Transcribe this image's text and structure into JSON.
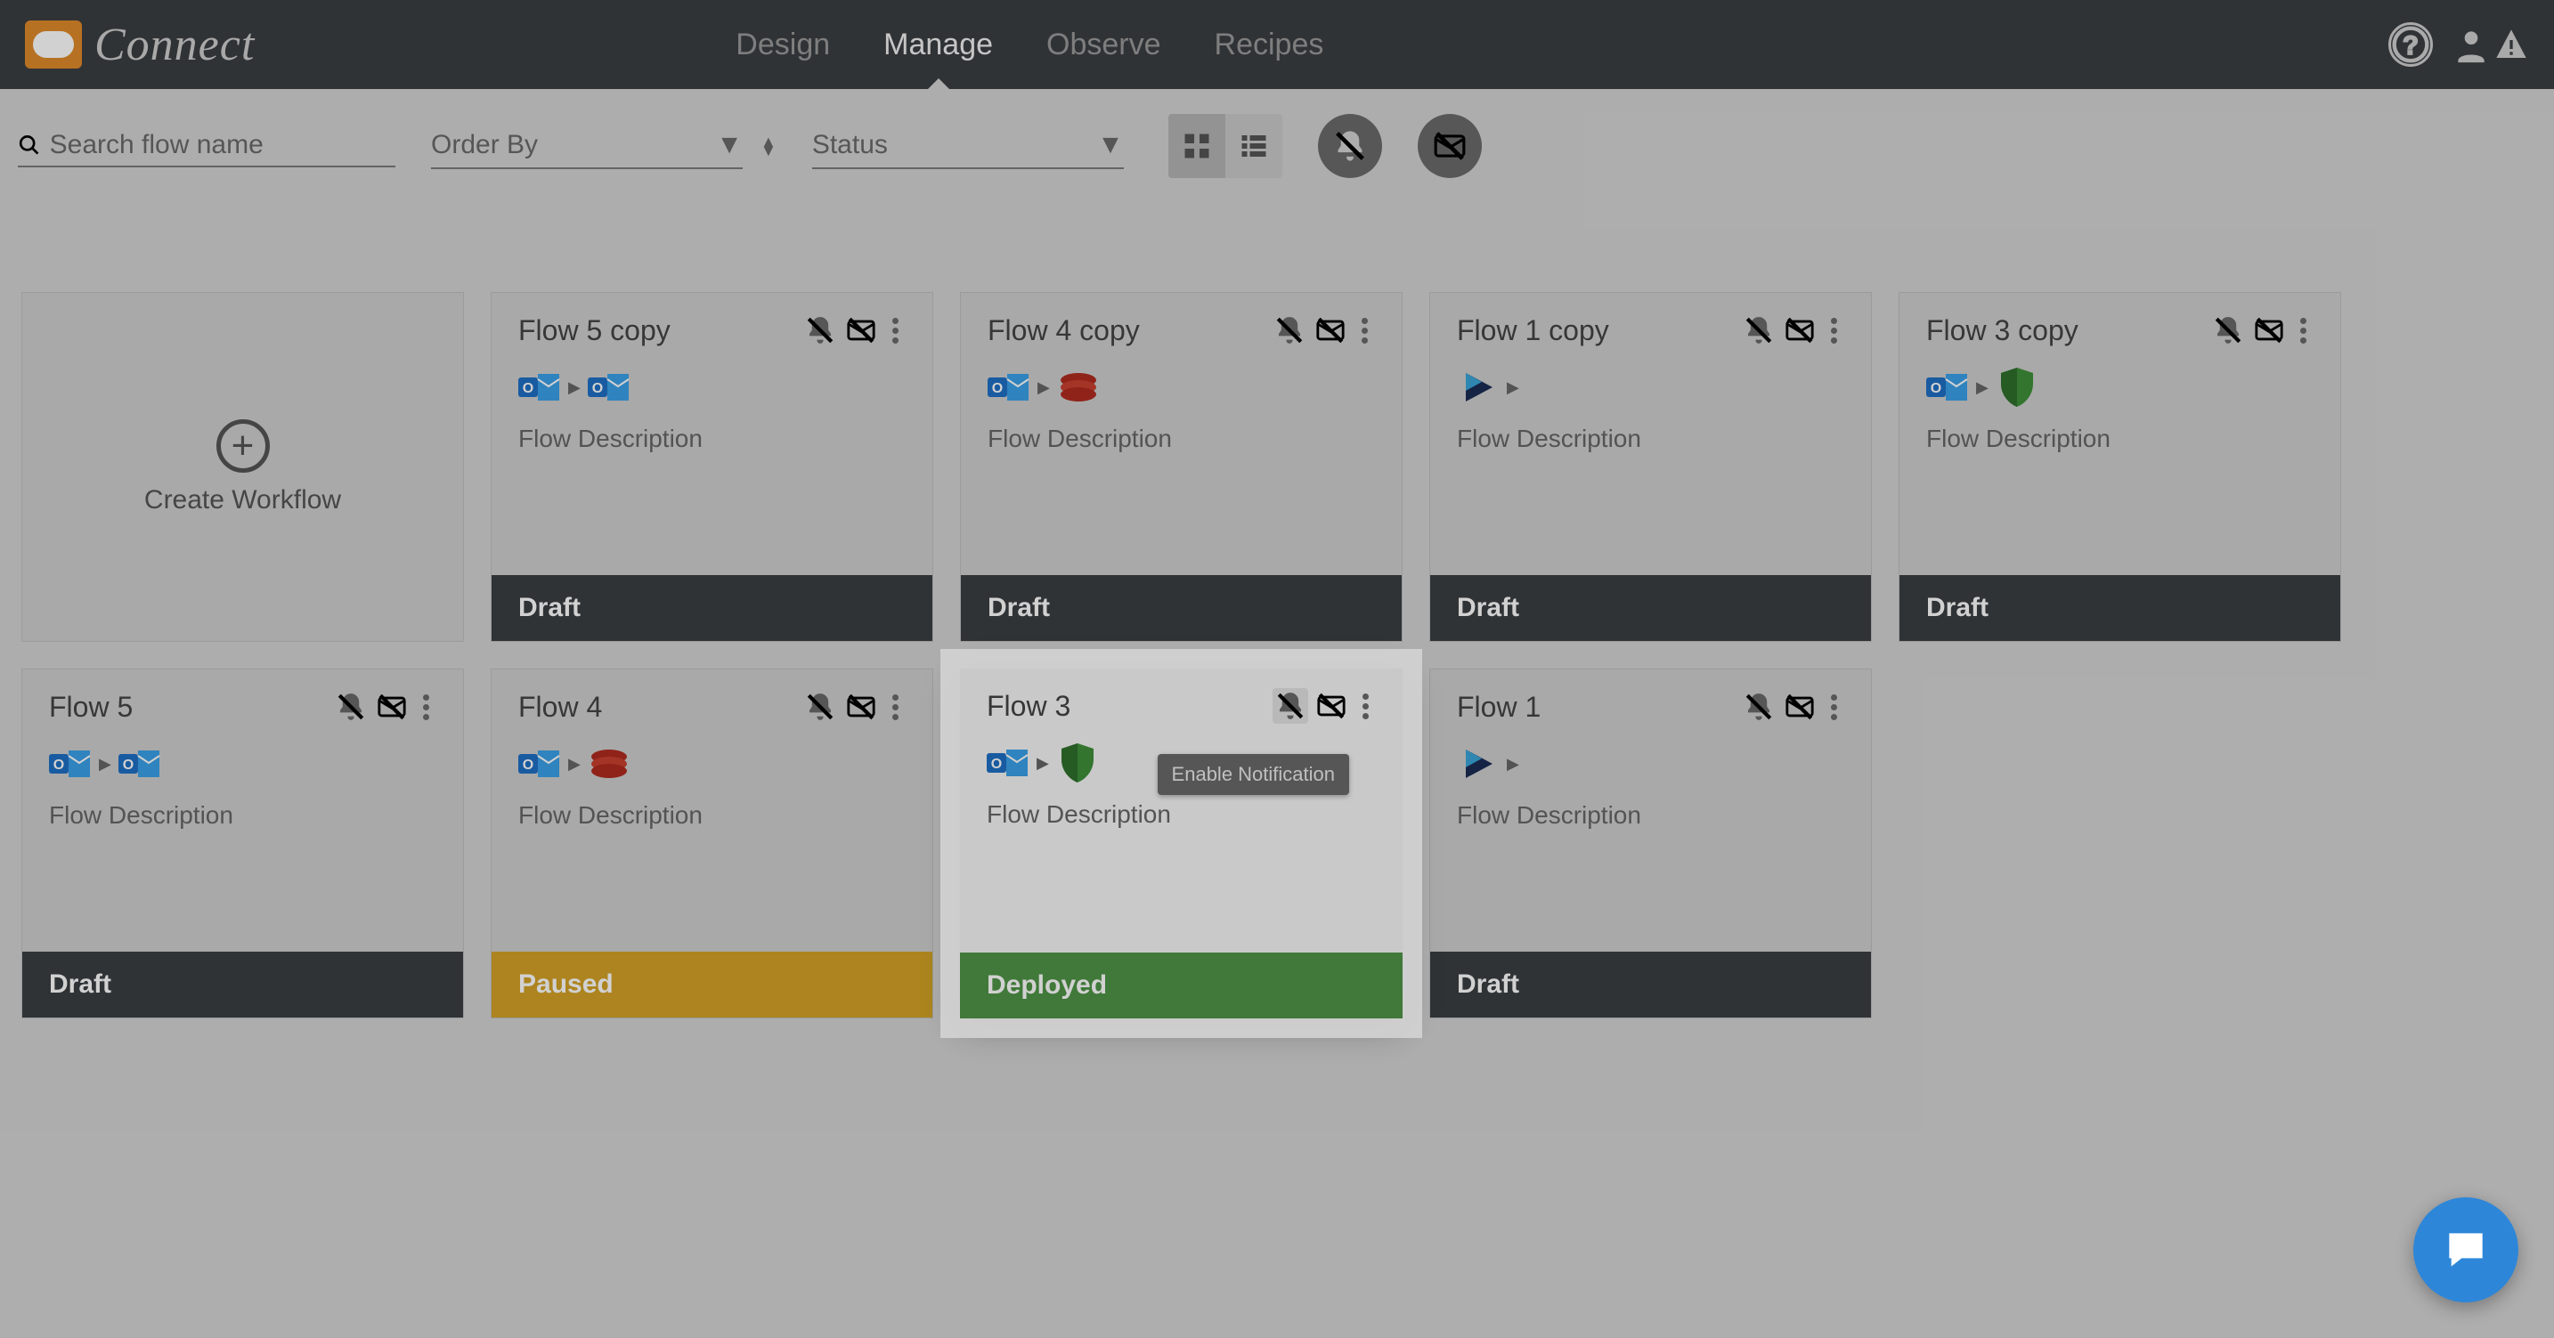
{
  "app": {
    "name": "Connect"
  },
  "nav": {
    "design": "Design",
    "manage": "Manage",
    "observe": "Observe",
    "recipes": "Recipes",
    "active": "manage"
  },
  "toolbar": {
    "search_placeholder": "Search flow name",
    "orderby_label": "Order By",
    "status_label": "Status"
  },
  "create_card": {
    "label": "Create Workflow"
  },
  "tooltip": {
    "enable_notification": "Enable Notification"
  },
  "status_labels": {
    "draft": "Draft",
    "paused": "Paused",
    "deployed": "Deployed"
  },
  "flows": [
    {
      "id": "f5c",
      "title": "Flow 5 copy",
      "desc": "Flow Description",
      "status": "draft",
      "connectors": [
        "outlook",
        "outlook"
      ]
    },
    {
      "id": "f4c",
      "title": "Flow 4 copy",
      "desc": "Flow Description",
      "status": "draft",
      "connectors": [
        "outlook",
        "redis"
      ]
    },
    {
      "id": "f1c",
      "title": "Flow 1 copy",
      "desc": "Flow Description",
      "status": "draft",
      "connectors": [
        "tri"
      ]
    },
    {
      "id": "f3c",
      "title": "Flow 3 copy",
      "desc": "Flow Description",
      "status": "draft",
      "connectors": [
        "outlook",
        "shield"
      ]
    },
    {
      "id": "f5",
      "title": "Flow 5",
      "desc": "Flow Description",
      "status": "draft",
      "connectors": [
        "outlook",
        "outlook"
      ]
    },
    {
      "id": "f4",
      "title": "Flow 4",
      "desc": "Flow Description",
      "status": "paused",
      "connectors": [
        "outlook",
        "redis"
      ]
    },
    {
      "id": "f3",
      "title": "Flow 3",
      "desc": "Flow Description",
      "status": "deployed",
      "connectors": [
        "outlook",
        "shield"
      ],
      "highlight": true,
      "notif_hover": true
    },
    {
      "id": "f1",
      "title": "Flow 1",
      "desc": "Flow Description",
      "status": "draft",
      "connectors": [
        "tri"
      ]
    }
  ]
}
